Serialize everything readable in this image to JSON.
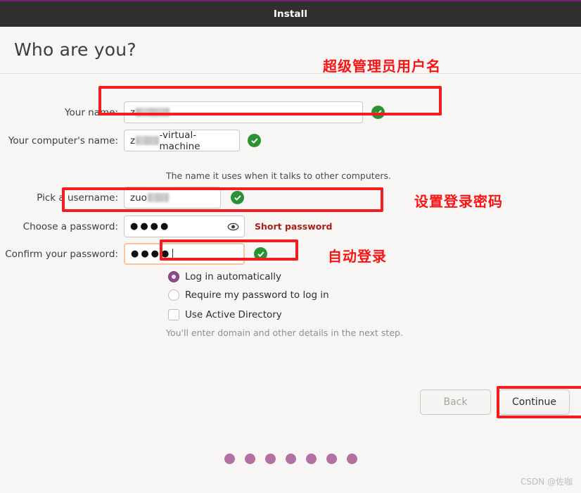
{
  "window": {
    "title": "Install"
  },
  "page": {
    "heading": "Who are you?"
  },
  "form": {
    "your_name": {
      "label": "Your name:",
      "value_prefix": "z",
      "value_redacted": true,
      "valid_icon": "check-circle-icon"
    },
    "computer_name": {
      "label": "Your computer's name:",
      "value_prefix": "z",
      "value_suffix": "-virtual-machine",
      "value_redacted": true,
      "hint": "The name it uses when it talks to other computers.",
      "valid_icon": "check-circle-icon"
    },
    "username": {
      "label": "Pick a username:",
      "value_prefix": "zuo",
      "value_redacted": true,
      "valid_icon": "check-circle-icon"
    },
    "password": {
      "label": "Choose a password:",
      "value_dots": "●●●●",
      "reveal_icon": "eye-icon",
      "strength_message": "Short password",
      "strength_color": "#a8201a"
    },
    "confirm_password": {
      "label": "Confirm your password:",
      "value_dots": "●●●●",
      "focused": true,
      "valid_icon": "check-circle-icon"
    }
  },
  "options": {
    "login_automatically": {
      "label": "Log in automatically",
      "selected": true,
      "accent": "#8d4a87"
    },
    "require_password": {
      "label": "Require my password to log in",
      "selected": false
    },
    "use_active_directory": {
      "label": "Use Active Directory",
      "checked": false,
      "hint": "You'll enter domain and other details in the next step."
    }
  },
  "buttons": {
    "back": {
      "label": "Back",
      "enabled": false
    },
    "continue": {
      "label": "Continue",
      "enabled": true
    }
  },
  "progress": {
    "total_dots": 7,
    "dot_color": "#a4528f"
  },
  "annotations": {
    "admin_username": "超级管理员用户名",
    "set_password": "设置登录密码",
    "auto_login": "自动登录",
    "color": "#f71414"
  },
  "watermark": "CSDN @佐咖"
}
